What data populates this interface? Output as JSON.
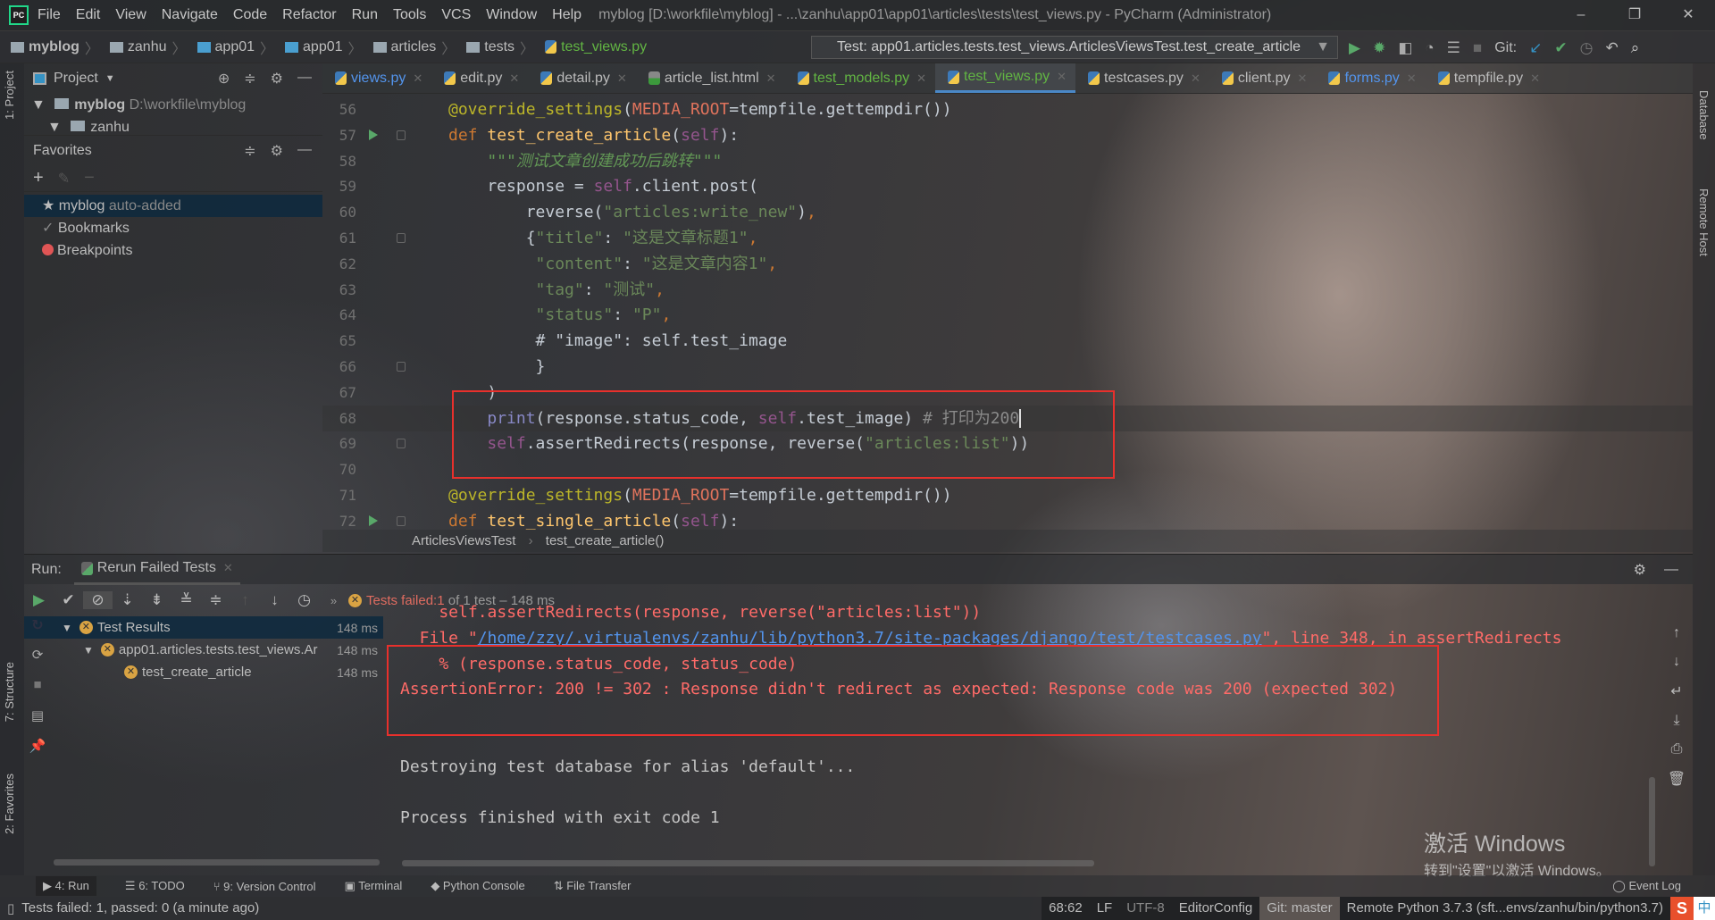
{
  "titlebar": {
    "menu": [
      "File",
      "Edit",
      "View",
      "Navigate",
      "Code",
      "Refactor",
      "Run",
      "Tools",
      "VCS",
      "Window",
      "Help"
    ],
    "window_title": "myblog [D:\\workfile\\myblog] - ...\\zanhu\\app01\\app01\\articles\\tests\\test_views.py - PyCharm (Administrator)",
    "controls": {
      "minimize": "–",
      "restore": "❐",
      "close": "✕"
    }
  },
  "breadcrumb": [
    "myblog",
    "zanhu",
    "app01",
    "app01",
    "articles",
    "tests",
    "test_views.py"
  ],
  "run_config": "Test: app01.articles.tests.test_views.ArticlesViewsTest.test_create_article",
  "git_label": "Git:",
  "project_panel": {
    "title": "Project",
    "root": "myblog",
    "root_path": "D:\\workfile\\myblog",
    "child": "zanhu"
  },
  "favorites": {
    "title": "Favorites",
    "items": [
      {
        "label": "myblog",
        "note": "auto-added"
      },
      {
        "label": "Bookmarks"
      },
      {
        "label": "Breakpoints"
      }
    ]
  },
  "left_stripe": [
    "1: Project",
    "7: Structure",
    "2: Favorites"
  ],
  "right_stripe": [
    "Database",
    "Remote Host"
  ],
  "tabs": [
    {
      "label": "views.py",
      "state": "blue"
    },
    {
      "label": "edit.py"
    },
    {
      "label": "detail.py"
    },
    {
      "label": "article_list.html"
    },
    {
      "label": "test_models.py",
      "state": "green"
    },
    {
      "label": "test_views.py",
      "state": "green",
      "active": true
    },
    {
      "label": "testcases.py"
    },
    {
      "label": "client.py"
    },
    {
      "label": "forms.py",
      "state": "blue"
    },
    {
      "label": "tempfile.py"
    }
  ],
  "code": [
    {
      "n": 56,
      "tokens": [
        [
          "deco",
          "@override_settings"
        ],
        [
          "plain",
          "("
        ],
        [
          "const",
          "MEDIA_ROOT"
        ],
        [
          "plain",
          "=tempfile.gettempdir())"
        ]
      ]
    },
    {
      "n": 57,
      "run": true,
      "fold": true,
      "tokens": [
        [
          "kw",
          "def "
        ],
        [
          "fn",
          "test_create_article"
        ],
        [
          "plain",
          "("
        ],
        [
          "self",
          "self"
        ],
        [
          "plain",
          "):"
        ]
      ]
    },
    {
      "n": 58,
      "tokens": [
        [
          "doc",
          "    \"\"\"测试文章创建成功后跳转\"\"\""
        ]
      ]
    },
    {
      "n": 59,
      "tokens": [
        [
          "plain",
          "    response = "
        ],
        [
          "self",
          "self"
        ],
        [
          "plain",
          ".client.post("
        ]
      ]
    },
    {
      "n": 60,
      "tokens": [
        [
          "plain",
          "        reverse("
        ],
        [
          "str",
          "\"articles:write_new\""
        ],
        [
          "plain",
          ")"
        ],
        [
          "kw",
          ","
        ]
      ]
    },
    {
      "n": 61,
      "fold": true,
      "tokens": [
        [
          "plain",
          "        {"
        ],
        [
          "str",
          "\"title\""
        ],
        [
          "plain",
          ": "
        ],
        [
          "str",
          "\"这是文章标题1\""
        ],
        [
          "kw",
          ","
        ]
      ]
    },
    {
      "n": 62,
      "tokens": [
        [
          "plain",
          "         "
        ],
        [
          "str",
          "\"content\""
        ],
        [
          "plain",
          ": "
        ],
        [
          "str",
          "\"这是文章内容1\""
        ],
        [
          "kw",
          ","
        ]
      ]
    },
    {
      "n": 63,
      "tokens": [
        [
          "plain",
          "         "
        ],
        [
          "str",
          "\"tag\""
        ],
        [
          "plain",
          ": "
        ],
        [
          "str",
          "\"测试\""
        ],
        [
          "kw",
          ","
        ]
      ]
    },
    {
      "n": 64,
      "tokens": [
        [
          "plain",
          "         "
        ],
        [
          "str",
          "\"status\""
        ],
        [
          "plain",
          ": "
        ],
        [
          "str",
          "\"P\""
        ],
        [
          "kw",
          ","
        ]
      ]
    },
    {
      "n": 65,
      "tokens": [
        [
          "plain",
          "         # \"image\": self.test_image"
        ]
      ]
    },
    {
      "n": 66,
      "fold": true,
      "tokens": [
        [
          "plain",
          "         }"
        ]
      ]
    },
    {
      "n": 67,
      "tokens": [
        [
          "plain",
          "    )"
        ]
      ]
    },
    {
      "n": 68,
      "current": true,
      "tokens": [
        [
          "plain",
          "    "
        ],
        [
          "bi",
          "print"
        ],
        [
          "plain",
          "(response.status_code, "
        ],
        [
          "self",
          "self"
        ],
        [
          "plain",
          ".test_image)"
        ],
        [
          "cm",
          " # 打印为200"
        ]
      ]
    },
    {
      "n": 69,
      "fold": true,
      "tokens": [
        [
          "plain",
          "    "
        ],
        [
          "self",
          "self"
        ],
        [
          "plain",
          ".assertRedirects(response, reverse("
        ],
        [
          "str",
          "\"articles:list\""
        ],
        [
          "plain",
          "))"
        ]
      ]
    },
    {
      "n": 70,
      "tokens": []
    },
    {
      "n": 71,
      "tokens": [
        [
          "deco",
          "@override_settings"
        ],
        [
          "plain",
          "("
        ],
        [
          "const",
          "MEDIA_ROOT"
        ],
        [
          "plain",
          "=tempfile.gettempdir())"
        ]
      ]
    },
    {
      "n": 72,
      "run": true,
      "fold": true,
      "tokens": [
        [
          "kw",
          "def "
        ],
        [
          "fn",
          "test_single_article"
        ],
        [
          "plain",
          "("
        ],
        [
          "self",
          "self"
        ],
        [
          "plain",
          "):"
        ]
      ]
    }
  ],
  "editor_breadcrumb": [
    "ArticlesViewsTest",
    "test_create_article()"
  ],
  "run_panel": {
    "label": "Run:",
    "tab": "Rerun Failed Tests",
    "status": {
      "prefix": "Tests failed: ",
      "failed": "1",
      "suffix": " of 1 test – 148 ms"
    },
    "tree": [
      {
        "label": "Test Results",
        "time": "148 ms"
      },
      {
        "label": "app01.articles.tests.test_views.Ar",
        "time": "148 ms"
      },
      {
        "label": "test_create_article",
        "time": "148 ms"
      }
    ],
    "console": [
      [
        [
          "red",
          "    self.assertRedirects(response, reverse(\"articles:list\"))"
        ]
      ],
      [
        [
          "red",
          "  File \""
        ],
        [
          "link",
          "/home/zzy/.virtualenvs/zanhu/lib/python3.7/site-packages/django/test/testcases.py"
        ],
        [
          "red",
          "\", line 348, in assertRedirects"
        ]
      ],
      [
        [
          "red",
          "    % (response.status_code, status_code)"
        ]
      ],
      [
        [
          "red",
          "AssertionError: 200 != 302 : Response didn't redirect as expected: Response code was 200 (expected 302)"
        ]
      ],
      [],
      [],
      [
        [
          "w",
          "Destroying test database for alias 'default'..."
        ]
      ],
      [],
      [
        [
          "w",
          "Process finished with exit code 1"
        ]
      ]
    ]
  },
  "watermark": {
    "line1": "激活 Windows",
    "line2": "转到\"设置\"以激活 Windows。"
  },
  "tool_windows": [
    "4: Run",
    "6: TODO",
    "9: Version Control",
    "Terminal",
    "Python Console",
    "File Transfer"
  ],
  "event_log": "Event Log",
  "status_bar": {
    "message": "Tests failed: 1, passed: 0 (a minute ago)",
    "position": "68:62",
    "line_sep": "LF",
    "encoding": "UTF-8",
    "editorconfig": "EditorConfig",
    "git": "Git: master",
    "interpreter": "Remote Python 3.7.3 (sft...envs/zanhu/bin/python3.7)",
    "ime": "中",
    "ime_logo": "S"
  },
  "colors": {
    "accent": "#4a88c7",
    "error": "#ff6b68",
    "highlight_box": "#e8302c",
    "run_green": "#59a869"
  }
}
